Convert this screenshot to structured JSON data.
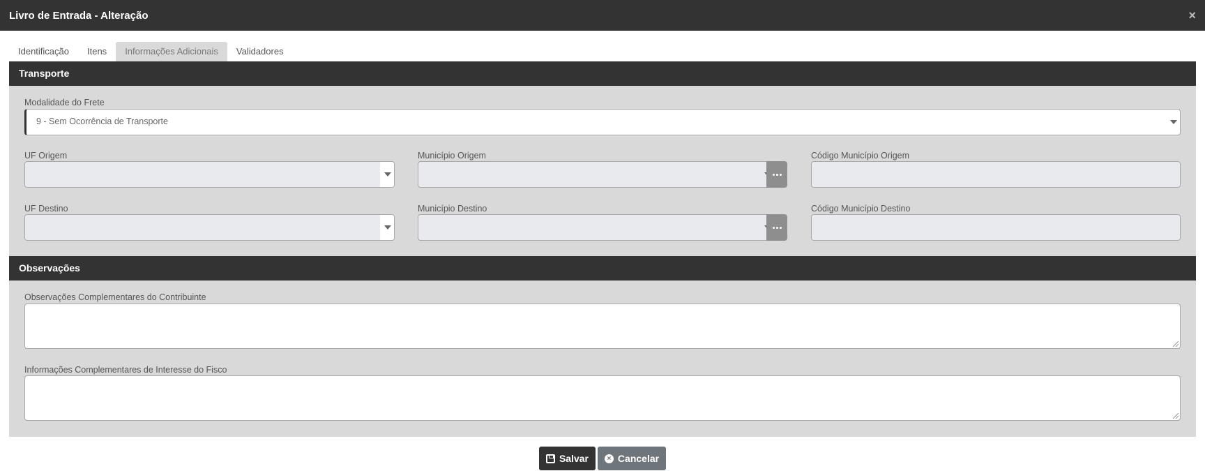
{
  "window": {
    "title": "Livro de Entrada - Alteração",
    "close_icon": "×"
  },
  "tabs": [
    {
      "label": "Identificação",
      "active": false
    },
    {
      "label": "Itens",
      "active": false
    },
    {
      "label": "Informações Adicionais",
      "active": true
    },
    {
      "label": "Validadores",
      "active": false
    }
  ],
  "transporte": {
    "heading": "Transporte",
    "modalidade_frete": {
      "label": "Modalidade do Frete",
      "value": "9 - Sem Ocorrência de Transporte"
    },
    "uf_origem": {
      "label": "UF Origem",
      "value": ""
    },
    "municipio_origem": {
      "label": "Município Origem",
      "value": ""
    },
    "codigo_municipio_origem": {
      "label": "Código Município Origem",
      "value": ""
    },
    "uf_destino": {
      "label": "UF Destino",
      "value": ""
    },
    "municipio_destino": {
      "label": "Município Destino",
      "value": ""
    },
    "codigo_municipio_destino": {
      "label": "Código Município Destino",
      "value": ""
    }
  },
  "observacoes": {
    "heading": "Observações",
    "contribuinte": {
      "label": "Observações Complementares do Contribuinte",
      "value": ""
    },
    "fisco": {
      "label": "Informações Complementares de Interesse do Fisco",
      "value": ""
    }
  },
  "actions": {
    "save_label": "Salvar",
    "cancel_label": "Cancelar"
  }
}
